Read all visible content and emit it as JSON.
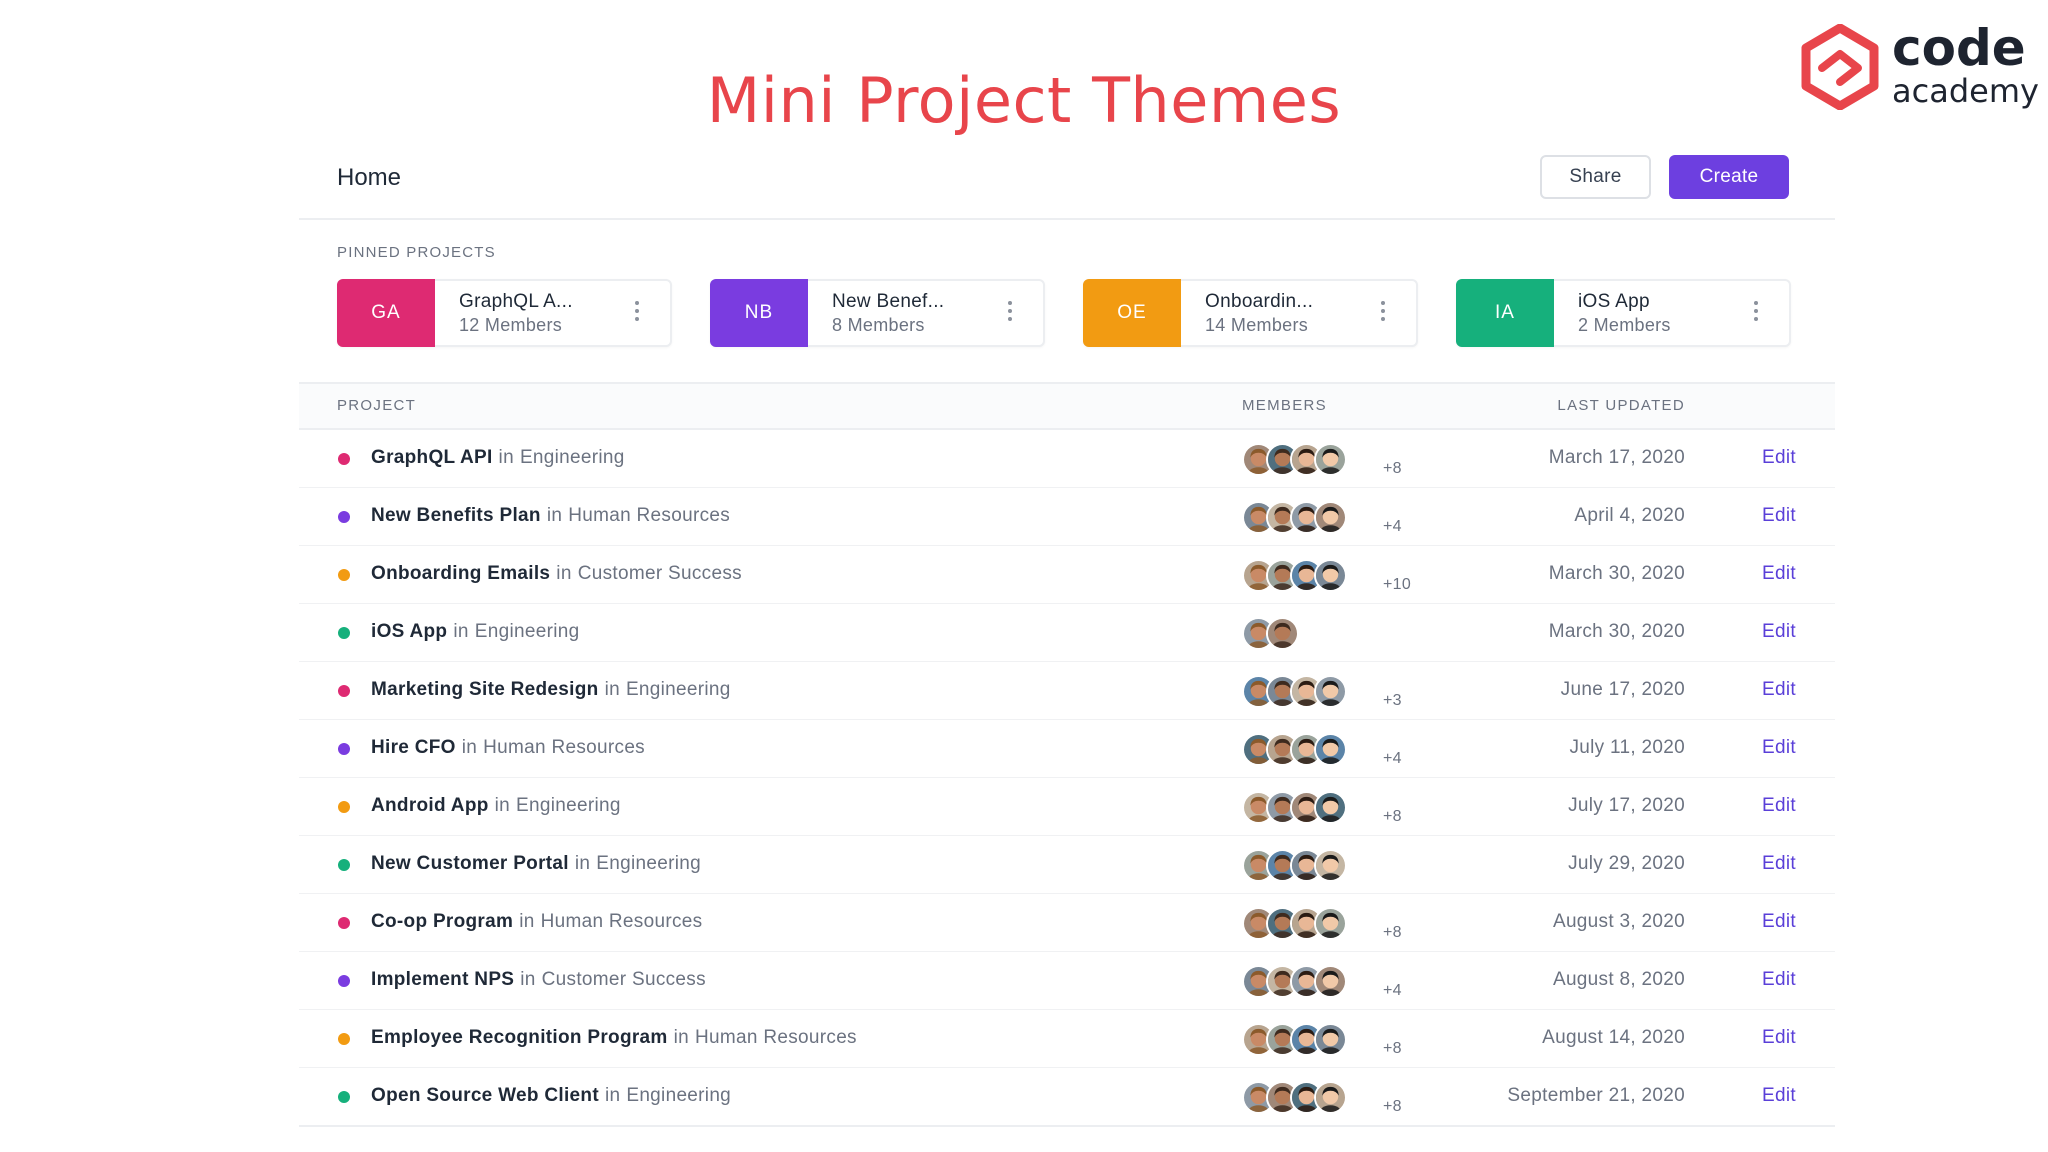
{
  "slide": {
    "title": "Mini Project Themes"
  },
  "logo": {
    "line1": "code",
    "line2": "academy",
    "color": "#e8454b"
  },
  "header": {
    "title": "Home",
    "share_label": "Share",
    "create_label": "Create",
    "accent": "#6d3fe0"
  },
  "pinned": {
    "label": "PINNED PROJECTS",
    "items": [
      {
        "initials": "GA",
        "name": "GraphQL A...",
        "members": "12 Members",
        "color": "#de2a72"
      },
      {
        "initials": "NB",
        "name": "New Benef...",
        "members": "8 Members",
        "color": "#7a3ce0"
      },
      {
        "initials": "OE",
        "name": "Onboardin...",
        "members": "14 Members",
        "color": "#f29b12"
      },
      {
        "initials": "IA",
        "name": "iOS App",
        "members": "2 Members",
        "color": "#16b07c"
      }
    ]
  },
  "table": {
    "headers": {
      "project": "PROJECT",
      "members": "MEMBERS",
      "updated": "LAST UPDATED"
    },
    "edit_label": "Edit",
    "in_word": "in",
    "rows": [
      {
        "name": "GraphQL API",
        "dept": "Engineering",
        "color": "#de2a72",
        "avatars": 4,
        "extra": "+8",
        "date": "March 17, 2020"
      },
      {
        "name": "New Benefits Plan",
        "dept": "Human Resources",
        "color": "#7a3ce0",
        "avatars": 4,
        "extra": "+4",
        "date": "April 4, 2020"
      },
      {
        "name": "Onboarding Emails",
        "dept": "Customer Success",
        "color": "#f29b12",
        "avatars": 4,
        "extra": "+10",
        "date": "March 30, 2020"
      },
      {
        "name": "iOS App",
        "dept": "Engineering",
        "color": "#16b07c",
        "avatars": 2,
        "extra": "",
        "date": "March 30, 2020"
      },
      {
        "name": "Marketing Site Redesign",
        "dept": "Engineering",
        "color": "#de2a72",
        "avatars": 4,
        "extra": "+3",
        "date": "June 17, 2020"
      },
      {
        "name": "Hire CFO",
        "dept": "Human Resources",
        "color": "#7a3ce0",
        "avatars": 4,
        "extra": "+4",
        "date": "July 11, 2020"
      },
      {
        "name": "Android App",
        "dept": "Engineering",
        "color": "#f29b12",
        "avatars": 4,
        "extra": "+8",
        "date": "July 17, 2020"
      },
      {
        "name": "New Customer Portal",
        "dept": "Engineering",
        "color": "#16b07c",
        "avatars": 4,
        "extra": "",
        "date": "July 29, 2020"
      },
      {
        "name": "Co-op Program",
        "dept": "Human Resources",
        "color": "#de2a72",
        "avatars": 4,
        "extra": "+8",
        "date": "August 3, 2020"
      },
      {
        "name": "Implement NPS",
        "dept": "Customer Success",
        "color": "#7a3ce0",
        "avatars": 4,
        "extra": "+4",
        "date": "August 8, 2020"
      },
      {
        "name": "Employee Recognition Program",
        "dept": "Human Resources",
        "color": "#f29b12",
        "avatars": 4,
        "extra": "+8",
        "date": "August 14, 2020"
      },
      {
        "name": "Open Source Web Client",
        "dept": "Engineering",
        "color": "#16b07c",
        "avatars": 4,
        "extra": "+8",
        "date": "September 21, 2020"
      }
    ]
  }
}
